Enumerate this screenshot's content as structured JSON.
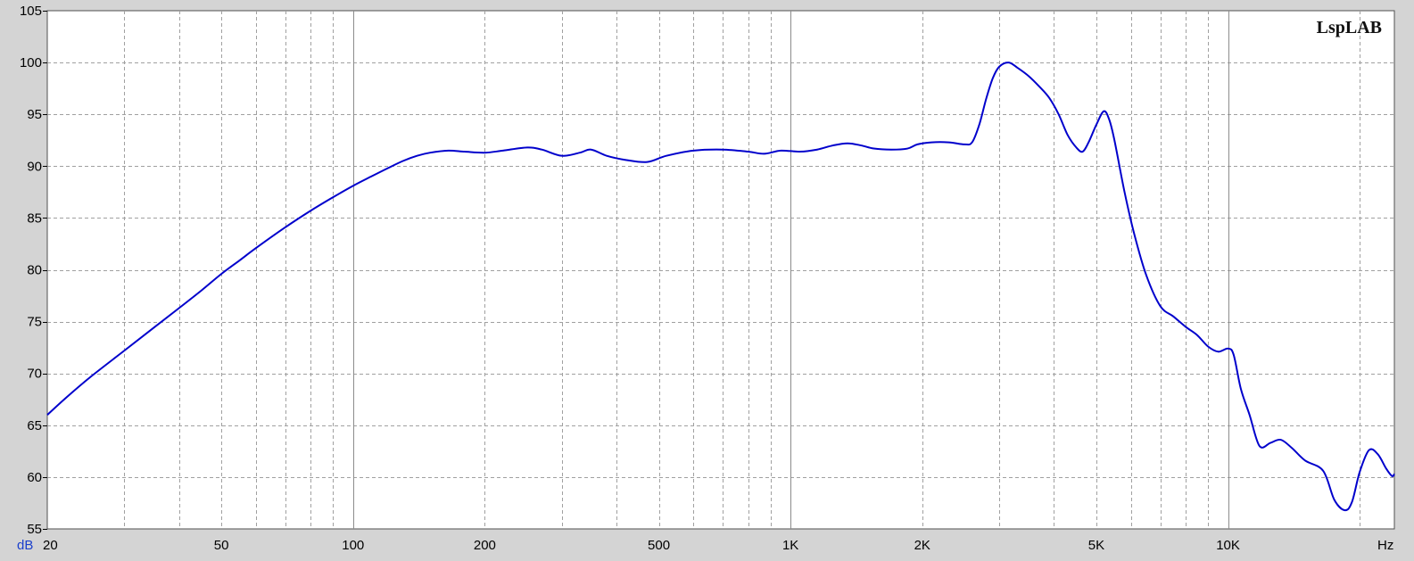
{
  "colors": {
    "background": "#d4d4d4",
    "plot_background": "#ffffff",
    "curve": "#0000cc",
    "unit_y": "#1a3fcc",
    "grid_major": "#8c8c8c",
    "grid_minor": "#a0a0a0"
  },
  "branding": {
    "logo_text": "LspLAB"
  },
  "chart_data": {
    "type": "line",
    "title": "",
    "xlabel": "Hz",
    "ylabel": "dB",
    "x_scale": "log",
    "xlim": [
      20,
      24000
    ],
    "ylim": [
      55,
      105
    ],
    "grid": true,
    "y_ticks": [
      55,
      60,
      65,
      70,
      75,
      80,
      85,
      90,
      95,
      100,
      105
    ],
    "x_ticks": [
      {
        "value": 20,
        "label": "20"
      },
      {
        "value": 50,
        "label": "50"
      },
      {
        "value": 100,
        "label": "100"
      },
      {
        "value": 200,
        "label": "200"
      },
      {
        "value": 500,
        "label": "500"
      },
      {
        "value": 1000,
        "label": "1K"
      },
      {
        "value": 2000,
        "label": "2K"
      },
      {
        "value": 5000,
        "label": "5K"
      },
      {
        "value": 10000,
        "label": "10K"
      }
    ],
    "x_grid_major": [
      100,
      1000,
      10000
    ],
    "x_grid_minor": [
      30,
      40,
      50,
      60,
      70,
      80,
      90,
      200,
      300,
      400,
      500,
      600,
      700,
      800,
      900,
      2000,
      3000,
      4000,
      5000,
      6000,
      7000,
      8000,
      9000,
      20000
    ],
    "series": [
      {
        "values": [
          [
            20,
            66.0
          ],
          [
            22,
            67.6
          ],
          [
            25,
            69.6
          ],
          [
            30,
            72.2
          ],
          [
            35,
            74.4
          ],
          [
            40,
            76.3
          ],
          [
            45,
            78.0
          ],
          [
            50,
            79.6
          ],
          [
            55,
            80.9
          ],
          [
            60,
            82.1
          ],
          [
            70,
            84.1
          ],
          [
            80,
            85.7
          ],
          [
            90,
            87.0
          ],
          [
            100,
            88.1
          ],
          [
            110,
            89.0
          ],
          [
            120,
            89.8
          ],
          [
            130,
            90.5
          ],
          [
            140,
            91.0
          ],
          [
            150,
            91.3
          ],
          [
            165,
            91.5
          ],
          [
            180,
            91.4
          ],
          [
            200,
            91.3
          ],
          [
            220,
            91.5
          ],
          [
            250,
            91.8
          ],
          [
            270,
            91.6
          ],
          [
            300,
            91.0
          ],
          [
            330,
            91.3
          ],
          [
            350,
            91.6
          ],
          [
            380,
            91.0
          ],
          [
            420,
            90.6
          ],
          [
            470,
            90.4
          ],
          [
            520,
            91.0
          ],
          [
            600,
            91.5
          ],
          [
            700,
            91.6
          ],
          [
            800,
            91.4
          ],
          [
            870,
            91.2
          ],
          [
            950,
            91.5
          ],
          [
            1050,
            91.4
          ],
          [
            1150,
            91.6
          ],
          [
            1250,
            92.0
          ],
          [
            1350,
            92.2
          ],
          [
            1450,
            92.0
          ],
          [
            1550,
            91.7
          ],
          [
            1700,
            91.6
          ],
          [
            1850,
            91.7
          ],
          [
            1950,
            92.1
          ],
          [
            2100,
            92.3
          ],
          [
            2300,
            92.3
          ],
          [
            2500,
            92.1
          ],
          [
            2600,
            92.3
          ],
          [
            2700,
            94.0
          ],
          [
            2800,
            96.5
          ],
          [
            2900,
            98.5
          ],
          [
            3000,
            99.6
          ],
          [
            3150,
            100.0
          ],
          [
            3300,
            99.5
          ],
          [
            3500,
            98.7
          ],
          [
            3700,
            97.7
          ],
          [
            3900,
            96.6
          ],
          [
            4100,
            95.0
          ],
          [
            4300,
            93.0
          ],
          [
            4500,
            91.8
          ],
          [
            4650,
            91.4
          ],
          [
            4800,
            92.3
          ],
          [
            5000,
            94.0
          ],
          [
            5200,
            95.3
          ],
          [
            5350,
            94.5
          ],
          [
            5500,
            92.5
          ],
          [
            5800,
            87.5
          ],
          [
            6100,
            83.5
          ],
          [
            6500,
            79.5
          ],
          [
            7000,
            76.5
          ],
          [
            7500,
            75.5
          ],
          [
            8000,
            74.5
          ],
          [
            8500,
            73.7
          ],
          [
            9000,
            72.6
          ],
          [
            9500,
            72.1
          ],
          [
            10000,
            72.4
          ],
          [
            10300,
            71.8
          ],
          [
            10700,
            68.5
          ],
          [
            11200,
            66.0
          ],
          [
            11800,
            63.0
          ],
          [
            12500,
            63.3
          ],
          [
            13200,
            63.6
          ],
          [
            14000,
            62.8
          ],
          [
            15000,
            61.6
          ],
          [
            16500,
            60.6
          ],
          [
            17500,
            57.8
          ],
          [
            18500,
            56.8
          ],
          [
            19200,
            57.6
          ],
          [
            20000,
            60.5
          ],
          [
            21000,
            62.6
          ],
          [
            22000,
            62.2
          ],
          [
            23000,
            60.8
          ],
          [
            23700,
            60.1
          ],
          [
            24000,
            60.3
          ]
        ]
      }
    ]
  }
}
